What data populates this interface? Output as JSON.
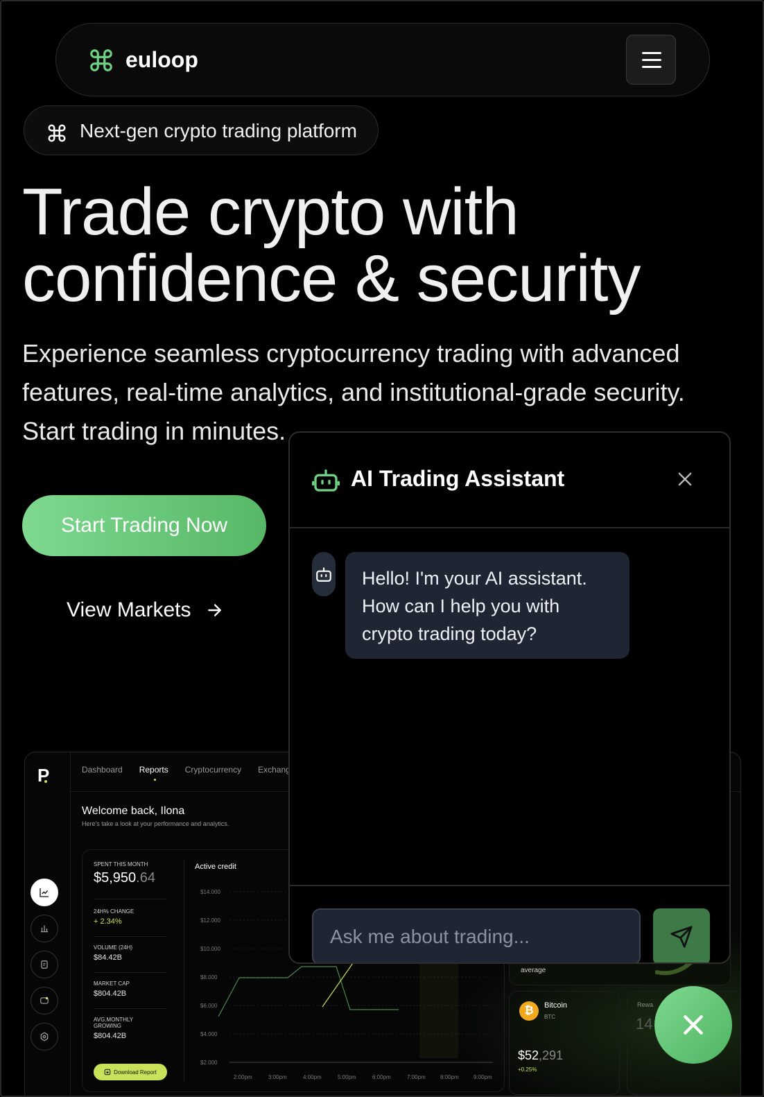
{
  "nav": {
    "brand": "euloop",
    "brand_color": "#6fd282",
    "menu_icon": "hamburger-icon"
  },
  "badge": {
    "text": "Next-gen crypto trading platform",
    "icon": "command-icon"
  },
  "hero": {
    "title_line1": "Trade crypto with",
    "title_line2": "confidence & security",
    "description": "Experience seamless cryptocurrency trading with advanced features, real-time analytics, and institutional-grade security. Start trading in minutes.",
    "cta_primary": "Start Trading Now",
    "cta_secondary": "View Markets"
  },
  "dashboard": {
    "logo": "P",
    "tabs": [
      "Dashboard",
      "Reports",
      "Cryptocurrency",
      "Exchange"
    ],
    "active_tab": "Reports",
    "welcome": "Welcome back, Ilona",
    "welcome_sub": "Here's  take a look at your performance and analytics.",
    "stats": {
      "spent_label": "SPENT THIS MONTH",
      "spent_main": "$5,950",
      "spent_cents": ".64",
      "change_label": "24H% CHANGE",
      "change_value": "+ 2.34%",
      "volume_label": "VOLUME (24H)",
      "volume_value": "$84.42B",
      "cap_label": "MARKET CAP",
      "cap_value": "$804.42B",
      "avg_label": "AVG.MONTHLY GROWING",
      "avg_value": "$804.42B",
      "download": "Download Report"
    },
    "chart_title": "Active credit",
    "y_ticks": [
      "$14.000",
      "$12.000",
      "$10.000",
      "$8.000",
      "$6.000",
      "$4.000",
      "$2.000"
    ],
    "x_ticks": [
      "2:00pm",
      "3:00pm",
      "4:00pm",
      "5:00pm",
      "6:00pm",
      "7:00pm",
      "8:00pm",
      "9:00pm"
    ],
    "credit_text": "Your credit score is average",
    "btc": {
      "name": "Bitcoin",
      "symbol": "BTC",
      "price_main": "$52",
      "price_rest": ",291",
      "change": "+0.25%"
    },
    "reward": {
      "label": "Rewa",
      "value": "14"
    }
  },
  "chat": {
    "title": "AI Trading Assistant",
    "message": "Hello! I'm your AI assistant. How can I help you with crypto trading today?",
    "placeholder": "Ask me about trading...",
    "accent": "#6fd282"
  }
}
